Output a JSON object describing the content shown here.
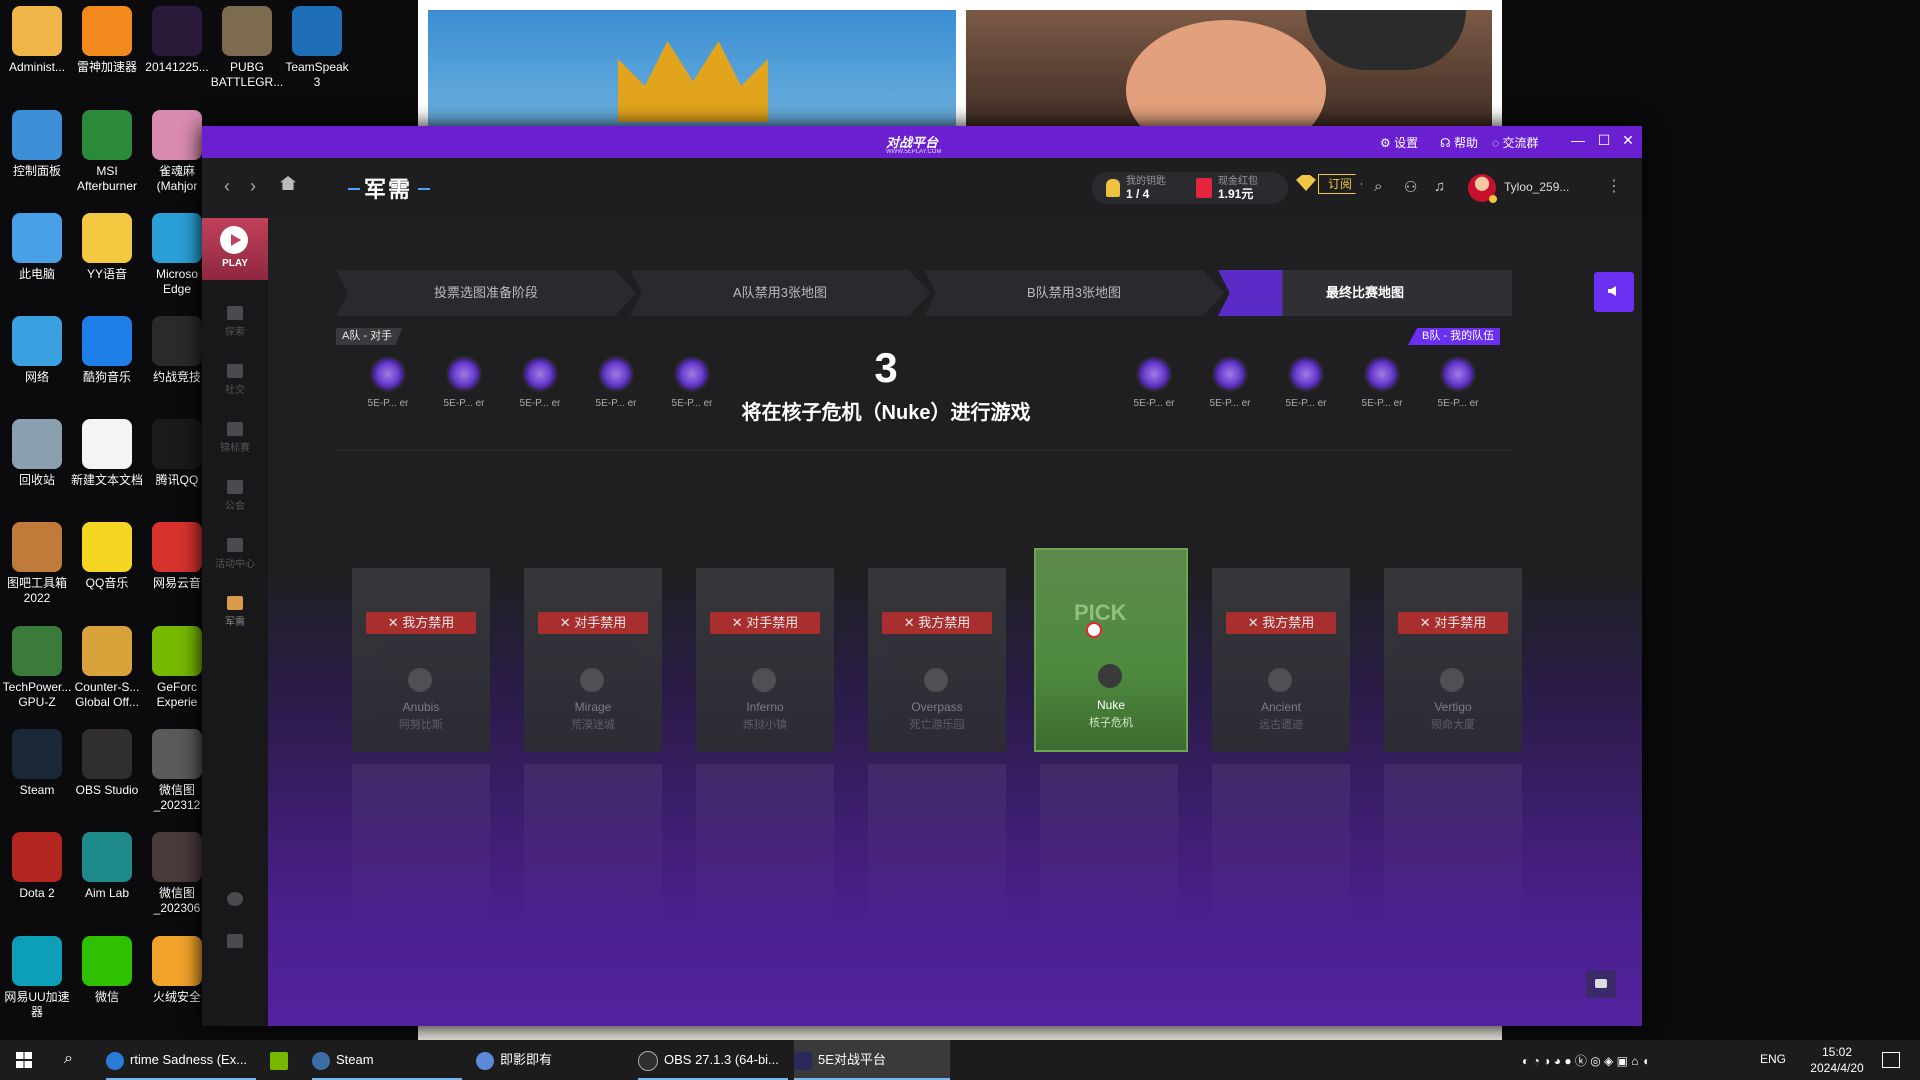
{
  "desktop": {
    "icons": [
      {
        "label": "Administ...",
        "color": "#f0b64a"
      },
      {
        "label": "雷神加速器",
        "color": "#f38a1e"
      },
      {
        "label": "20141225...",
        "color": "#2a1a3a"
      },
      {
        "label": "PUBG\nBATTLEGR...",
        "color": "#7d6b4f"
      },
      {
        "label": "TeamSpeak\n3",
        "color": "#1e6fb8"
      },
      {
        "label": "控制面板",
        "color": "#3c8fd6"
      },
      {
        "label": "MSI\nAfterburner",
        "color": "#2a8a3a"
      },
      {
        "label": "雀魂麻\n(Mahjor",
        "color": "#d98cb0"
      },
      {
        "label": "此电脑",
        "color": "#4aa0e6"
      },
      {
        "label": "YY语音",
        "color": "#f5c842"
      },
      {
        "label": "Microso\nEdge",
        "color": "#2a9fd8"
      },
      {
        "label": "网络",
        "color": "#3aa0e0"
      },
      {
        "label": "酷狗音乐",
        "color": "#1e7fe8"
      },
      {
        "label": "约战竞技",
        "color": "#2a2a2a"
      },
      {
        "label": "回收站",
        "color": "#8aa0b0"
      },
      {
        "label": "新建文本文档",
        "color": "#f4f4f4"
      },
      {
        "label": "腾讯QQ",
        "color": "#1a1a1a"
      },
      {
        "label": "图吧工具箱\n2022",
        "color": "#c07a3a"
      },
      {
        "label": "QQ音乐",
        "color": "#f5d623"
      },
      {
        "label": "网易云音",
        "color": "#d8322e"
      },
      {
        "label": "TechPower...\nGPU-Z",
        "color": "#3a7a3a"
      },
      {
        "label": "Counter-S...\nGlobal Off...",
        "color": "#d9a23a"
      },
      {
        "label": "GeForc\nExperie",
        "color": "#76b900"
      },
      {
        "label": "Steam",
        "color": "#1b2838"
      },
      {
        "label": "OBS Studio",
        "color": "#302e31"
      },
      {
        "label": "微信图\n_202312",
        "color": "#5a5a5a"
      },
      {
        "label": "Dota 2",
        "color": "#b3251f"
      },
      {
        "label": "Aim Lab",
        "color": "#1e8a8a"
      },
      {
        "label": "微信图\n_202306",
        "color": "#4a3a3a"
      },
      {
        "label": "网易UU加速\n器",
        "color": "#0e9fb8"
      },
      {
        "label": "微信",
        "color": "#2dc100"
      },
      {
        "label": "火绒安全",
        "color": "#f2a32a"
      }
    ]
  },
  "app": {
    "logo": "对战平台",
    "logo_sub": "WWW.5EPLAY.COM",
    "titlebar": {
      "settings": "设置",
      "help": "帮助",
      "group": "交流群",
      "minimize": "—",
      "maximize": "☐",
      "close": "✕"
    },
    "header": {
      "back": "‹",
      "forward": "›",
      "title": "军需",
      "keys_label": "我的钥匙",
      "keys_value": "1 / 4",
      "redpacket_label": "现金红包",
      "redpacket_value": "1.91元",
      "subscribe": "订阅",
      "username": "Tyloo_259...",
      "more": "⋮"
    },
    "sidebar": {
      "play": "PLAY",
      "items": [
        "探索",
        "社交",
        "锦标赛",
        "公会",
        "活动中心",
        "军需"
      ]
    },
    "accent_color": "#6a2ff0",
    "stages": [
      "投票选图准备阶段",
      "A队禁用3张地图",
      "B队禁用3张地图",
      "最终比赛地图"
    ],
    "team_a_label": "A队 - 对手",
    "team_b_label": "B队 - 我的队伍",
    "team_a_players": [
      "5E-P... er",
      "5E-P... er",
      "5E-P... er",
      "5E-P... er",
      "5E-P... er"
    ],
    "team_b_players": [
      "5E-P... er",
      "5E-P... er",
      "5E-P... er",
      "5E-P... er",
      "5E-P... er"
    ],
    "countdown": "3",
    "message": "将在核子危机（Nuke）进行游戏",
    "maps": [
      {
        "en": "Anubis",
        "cn": "阿努比斯",
        "ban": "✕ 我方禁用"
      },
      {
        "en": "Mirage",
        "cn": "荒漠迷城",
        "ban": "✕ 对手禁用"
      },
      {
        "en": "Inferno",
        "cn": "炼狱小镇",
        "ban": "✕ 对手禁用"
      },
      {
        "en": "Overpass",
        "cn": "死亡游乐园",
        "ban": "✕ 我方禁用"
      },
      {
        "en": "Nuke",
        "cn": "核子危机",
        "pick": "PICK"
      },
      {
        "en": "Ancient",
        "cn": "远古遗迹",
        "ban": "✕ 我方禁用"
      },
      {
        "en": "Vertigo",
        "cn": "殒命大厦",
        "ban": "✕ 对手禁用"
      }
    ]
  },
  "taskbar": {
    "tasks": [
      "rtime Sadness (Ex...",
      "Steam",
      "即影即有",
      "OBS 27.1.3 (64-bi...",
      "5E对战平台"
    ],
    "lang": "ENG",
    "time": "15:02",
    "date": "2024/4/20"
  }
}
